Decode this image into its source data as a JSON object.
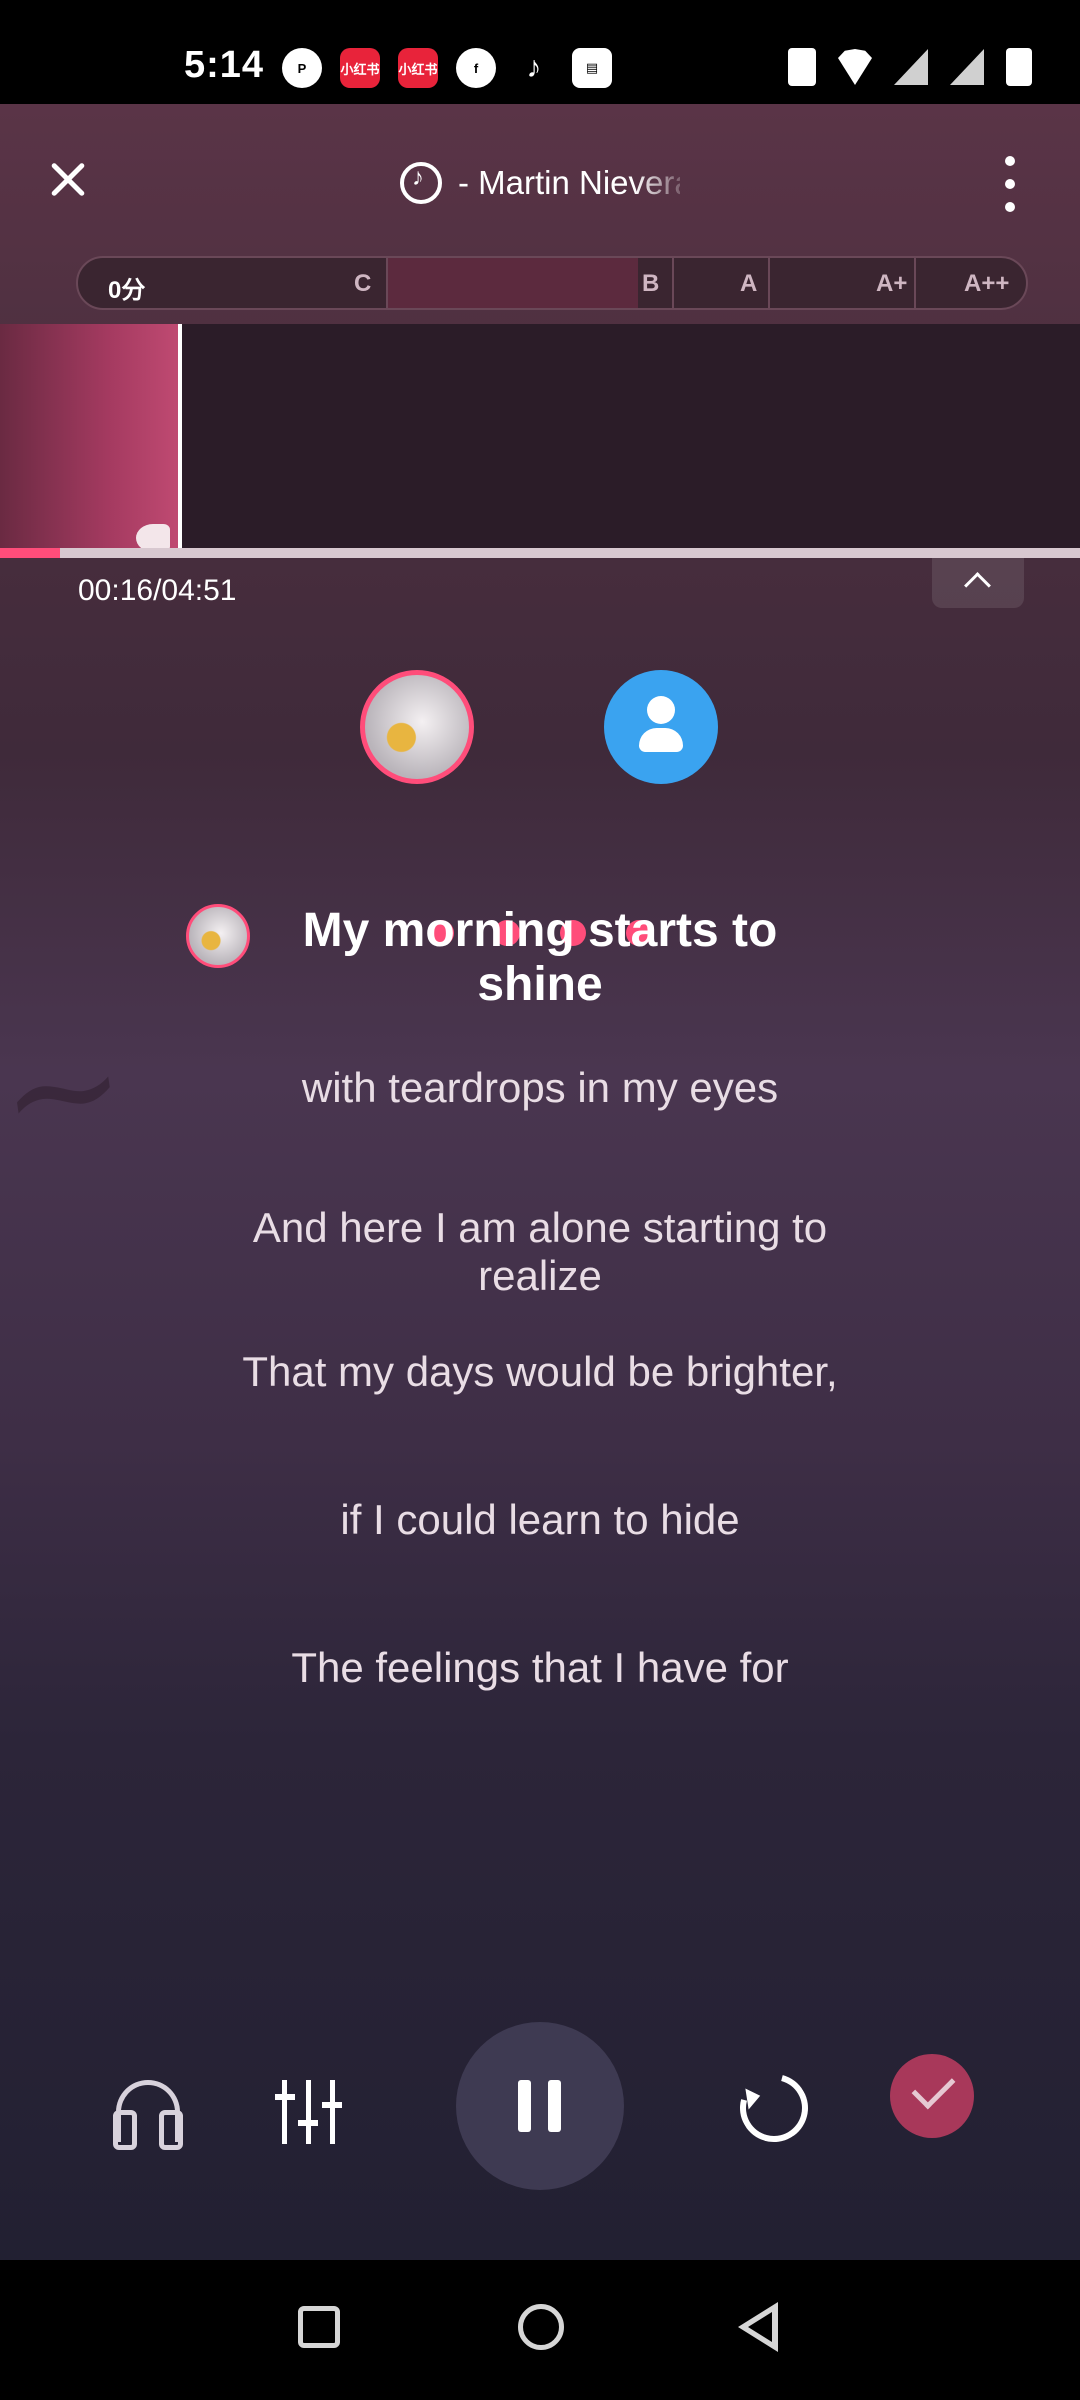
{
  "status_bar": {
    "time": "5:14",
    "left_icons": [
      "app-icon-1",
      "xiaohongshu-icon-1",
      "xiaohongshu-icon-2",
      "facebook-icon",
      "tiktok-icon",
      "app-icon-2"
    ],
    "xhs_label": "小红书",
    "right_icons": [
      "vibrate-icon",
      "wifi-icon",
      "signal-icon-1",
      "signal-icon-2",
      "battery-icon"
    ]
  },
  "header": {
    "song_title": "- Martin Nievera",
    "close_icon": "close-icon",
    "more_icon": "more-vertical-icon"
  },
  "score_bar": {
    "current": "0分",
    "grades": [
      "C",
      "B",
      "A",
      "A+",
      "A++"
    ]
  },
  "playback": {
    "time": "00:16/04:51",
    "progress_fraction": 0.056
  },
  "lyrics": {
    "current": "My morning starts to shine",
    "lines": [
      "with teardrops in my eyes",
      "And here I am alone starting to realize",
      "That my days would be brighter,",
      "if I could learn to hide",
      "The feelings that I have for"
    ]
  },
  "controls": {
    "icons": [
      "headphone-icon",
      "mixer-icon",
      "pause-icon",
      "restart-icon",
      "checkmark-icon"
    ]
  },
  "colors": {
    "accent": "#ff4d7a",
    "finish": "#a8385a",
    "avatar_blue": "#3aa3f0"
  }
}
